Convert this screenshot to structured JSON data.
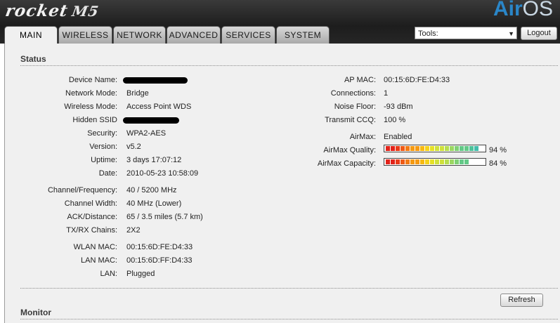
{
  "brand": {
    "name": "rocket",
    "model": "M5",
    "os_air": "Air",
    "os_os": "OS"
  },
  "tabs": [
    "MAIN",
    "WIRELESS",
    "NETWORK",
    "ADVANCED",
    "SERVICES",
    "SYSTEM"
  ],
  "tools": {
    "label": "Tools:"
  },
  "logout_label": "Logout",
  "status": {
    "title": "Status",
    "left": [
      {
        "label": "Device Name:",
        "value": ""
      },
      {
        "label": "Network Mode:",
        "value": "Bridge"
      },
      {
        "label": "Wireless Mode:",
        "value": "Access Point WDS"
      },
      {
        "label": "Hidden SSID",
        "value": ""
      },
      {
        "label": "Security:",
        "value": "WPA2-AES"
      },
      {
        "label": "Version:",
        "value": "v5.2"
      },
      {
        "label": "Uptime:",
        "value": "3 days 17:07:12"
      },
      {
        "label": "Date:",
        "value": "2010-05-23 10:58:09"
      },
      {
        "label": "Channel/Frequency:",
        "value": "40 / 5200 MHz"
      },
      {
        "label": "Channel Width:",
        "value": "40 MHz (Lower)"
      },
      {
        "label": "ACK/Distance:",
        "value": "65 / 3.5 miles (5.7 km)"
      },
      {
        "label": "TX/RX Chains:",
        "value": "2X2"
      },
      {
        "label": "WLAN MAC:",
        "value": "00:15:6D:FE:D4:33"
      },
      {
        "label": "LAN MAC:",
        "value": "00:15:6D:FF:D4:33"
      },
      {
        "label": "LAN:",
        "value": "Plugged"
      }
    ],
    "right": [
      {
        "label": "AP MAC:",
        "value": "00:15:6D:FE:D4:33"
      },
      {
        "label": "Connections:",
        "value": "1"
      },
      {
        "label": "Noise Floor:",
        "value": "-93 dBm"
      },
      {
        "label": "Transmit CCQ:",
        "value": "100 %"
      },
      {
        "label": "AirMax:",
        "value": "Enabled"
      }
    ],
    "airmax_quality": {
      "label": "AirMax Quality:",
      "percent": 94,
      "text": "94 %"
    },
    "airmax_capacity": {
      "label": "AirMax Capacity:",
      "percent": 84,
      "text": "84 %"
    }
  },
  "refresh_label": "Refresh",
  "monitor": {
    "title": "Monitor"
  }
}
